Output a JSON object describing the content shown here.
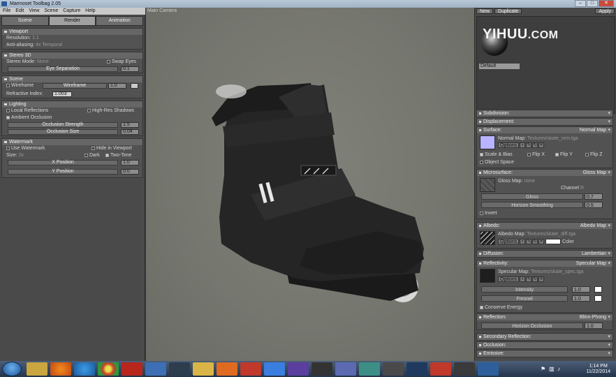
{
  "window": {
    "title": "Marmoset Toolbag 2.05",
    "minimize": "–",
    "maximize": "□",
    "close": "✕"
  },
  "menu": [
    "File",
    "Edit",
    "View",
    "Scene",
    "Capture",
    "Help"
  ],
  "left_tabs": [
    "Scene",
    "Render",
    "Animation"
  ],
  "viewport_section": {
    "title": "Viewport",
    "resolution_label": "Resolution:",
    "resolution_value": "1:1",
    "aa_label": "Anti-aliasing:",
    "aa_value": "4x Temporal"
  },
  "stereo_section": {
    "title": "Stereo 3D",
    "mode_label": "Stereo Mode:",
    "mode_value": "None",
    "swap_eyes": "Swap Eyes",
    "eye_sep_label": "Eye Separation",
    "eye_sep_value": "0.1"
  },
  "scene_section": {
    "title": "Scene",
    "wireframe_label": "Wireframe",
    "wireframe_slider": "Wireframe",
    "wireframe_value": "1.0",
    "refractive_label": "Refractive Index:",
    "refractive_value": "1.003"
  },
  "lighting_section": {
    "title": "Lighting",
    "local_reflections": "Local Reflections",
    "high_res_shadows": "High-Res Shadows",
    "ambient_occlusion": "Ambient Occlusion",
    "occlusion_strength": "Occlusion Strength",
    "occlusion_strength_value": "1.5",
    "occlusion_size": "Occlusion Size",
    "occlusion_size_value": "0.04"
  },
  "watermark_section": {
    "title": "Watermark",
    "use_watermark": "Use Watermark",
    "hide_in_viewport": "Hide in Viewport",
    "size_label": "Size:",
    "size_value": "2x",
    "dark": "Dark",
    "two_tone": "Two-Tone",
    "x_position": "X Position",
    "x_value": "1.0",
    "y_position": "Y Position",
    "y_value": "0.0"
  },
  "viewport": {
    "camera_label": "Main Camera"
  },
  "right_top": {
    "new_button": "New",
    "duplicate_button": "Duplicate",
    "apply_button": "Apply",
    "material_name": "Default"
  },
  "watermark_overlay": {
    "brand": "YIHUU",
    "suffix": ".COM"
  },
  "subdivision": {
    "title": "Subdivision:"
  },
  "displacement": {
    "title": "Displacement:"
  },
  "surface": {
    "title": "Surface:",
    "type": "Normal Map",
    "map_label": "Normal Map:",
    "map_path": "Textures/skate_nrm.tga",
    "options": "Options",
    "scale_bias": "Scale & Bias",
    "flip_x": "Flip X",
    "flip_y": "Flip Y",
    "flip_z": "Flip Z",
    "object_space": "Object Space"
  },
  "microsurface": {
    "title": "Microsurface:",
    "type": "Gloss Map",
    "map_label": "Gloss Map:",
    "map_path": "none",
    "channel_label": "Channel",
    "channel_value": "R",
    "gloss_label": "Gloss",
    "gloss_value": "0.7",
    "horizon_label": "Horizon Smoothing",
    "horizon_value": "0.5",
    "invert": "Invert"
  },
  "albedo": {
    "title": "Albedo:",
    "type": "Albedo Map",
    "map_label": "Albedo Map:",
    "map_path": "Textures/skate_diff.tga",
    "options": "Options",
    "color": "Color"
  },
  "diffusion": {
    "title": "Diffusion:",
    "type": "Lambertian"
  },
  "reflectivity": {
    "title": "Reflectivity:",
    "type": "Specular Map",
    "map_label": "Specular Map:",
    "map_path": "Textures/skate_spec.tga",
    "options": "Options",
    "intensity_label": "Intensity",
    "intensity_value": "1.0",
    "fresnel_label": "Fresnel",
    "fresnel_value": "1.0",
    "conserve": "Conserve Energy"
  },
  "reflection": {
    "title": "Reflection:",
    "type": "Blinn-Phong",
    "horizon_label": "Horizon Occlusion",
    "horizon_value": "1.0"
  },
  "secondary_reflection": {
    "title": "Secondary Reflection:"
  },
  "occlusion": {
    "title": "Occlusion:"
  },
  "emissive": {
    "title": "Emissive:"
  },
  "taskbar": {
    "time": "1:14 PM",
    "date": "11/22/2014",
    "apps": [
      "explorer",
      "firefox",
      "ie",
      "chrome",
      "filezilla",
      "app",
      "monitor",
      "files",
      "media",
      "jet",
      "dropbox",
      "app2",
      "ninja",
      "app3",
      "paint",
      "zbrush",
      "photoshop",
      "app4",
      "app5",
      "app6"
    ]
  }
}
